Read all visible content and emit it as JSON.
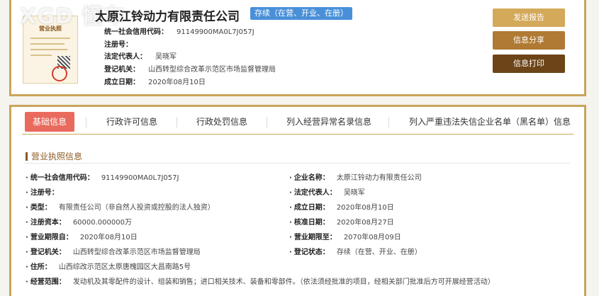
{
  "watermark": "XGD 懂车",
  "license_thumbnail": {
    "title": "营业执照"
  },
  "company": {
    "name": "太原江铃动力有限责任公司",
    "status": "存续（在营、开业、在册）",
    "credit_code_label": "统一社会信用代码：",
    "credit_code": "91149900MA0L7J057J",
    "reg_no_label": "注册号：",
    "reg_no": "",
    "legal_rep_label": "法定代表人：",
    "legal_rep": "吴晓军",
    "authority_label": "登记机关：",
    "authority": "山西转型综合改革示范区市场监督管理局",
    "founded_label": "成立日期：",
    "founded": "2020年08月10日"
  },
  "actions": {
    "send_report": "发送报告",
    "share": "信息分享",
    "print": "信息打印"
  },
  "tabs": [
    {
      "label": "基础信息",
      "active": true
    },
    {
      "label": "行政许可信息",
      "active": false
    },
    {
      "label": "行政处罚信息",
      "active": false
    },
    {
      "label": "列入经营异常名录信息",
      "active": false
    },
    {
      "label": "列入严重违法失信企业名单（黑名单）信息",
      "active": false
    }
  ],
  "section_title": "营业执照信息",
  "details": {
    "credit_code": {
      "label": "统一社会信用代码：",
      "value": "91149900MA0L7J057J"
    },
    "company_name": {
      "label": "企业名称：",
      "value": "太原江铃动力有限责任公司"
    },
    "reg_no": {
      "label": "注册号：",
      "value": ""
    },
    "legal_rep": {
      "label": "法定代表人：",
      "value": "吴晓军"
    },
    "type": {
      "label": "类型：",
      "value": "有限责任公司（非自然人投资或控股的法人独资）"
    },
    "founded": {
      "label": "成立日期：",
      "value": "2020年08月10日"
    },
    "capital": {
      "label": "注册资本：",
      "value": "60000.000000万"
    },
    "approval_date": {
      "label": "核准日期：",
      "value": "2020年08月27日"
    },
    "term_from": {
      "label": "营业期限自：",
      "value": "2020年08月10日"
    },
    "term_to": {
      "label": "营业期限至：",
      "value": "2070年08月09日"
    },
    "authority": {
      "label": "登记机关：",
      "value": "山西转型综合改革示范区市场监督管理局"
    },
    "reg_status": {
      "label": "登记状态：",
      "value": "存续（在营、开业、在册）"
    },
    "address": {
      "label": "住所：",
      "value": "山西综改示范区太原唐槐园区大昌南路5号"
    },
    "scope": {
      "label": "经营范围：",
      "value": "发动机及其零配件的设计、组装和销售；进口相关技术、装备和零部件。（依法须经批准的项目，经相关部门批准后方可开展经营活动）"
    }
  },
  "colors": {
    "accent_gold": "#c9a55a",
    "tab_active": "#e96b5e",
    "status_blue": "#4a90d9",
    "btn_report": "#d4a95a",
    "btn_share": "#b07a35",
    "btn_print": "#6d4417"
  }
}
